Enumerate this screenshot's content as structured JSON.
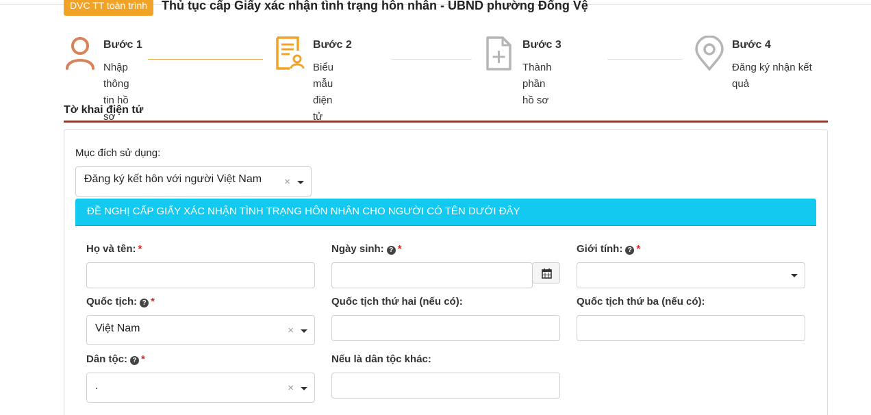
{
  "header": {
    "badge": "DVC TT toàn trình",
    "title": "Thủ tục cấp Giấy xác nhận tình trạng hôn nhân - UBND phường Đống Vệ"
  },
  "steps": [
    {
      "title": "Bước 1",
      "desc": "Nhập thông tin hồ sơ",
      "icon": "user-icon",
      "color": "#d9825a"
    },
    {
      "title": "Bước 2",
      "desc": "Biểu mẫu điện tử",
      "icon": "form-user-icon",
      "color": "#f0a326"
    },
    {
      "title": "Bước 3",
      "desc": "Thành phần hồ sơ",
      "icon": "file-add-icon",
      "color": "#b5b5b5"
    },
    {
      "title": "Bước 4",
      "desc": "Đăng ký nhận kết quả",
      "icon": "location-pin-icon",
      "color": "#b5b5b5"
    }
  ],
  "section": {
    "title": "Tờ khai điện tử"
  },
  "form": {
    "purpose_label": "Mục đích sử dụng:",
    "purpose_value": "Đăng ký kết hôn với người Việt Nam",
    "banner": "ĐỀ NGHỊ CẤP GIẤY XÁC NHẬN TÌNH TRẠNG HÔN NHÂN CHO NGƯỜI CÓ TÊN DƯỚI ĐÂY",
    "fullname_label": "Họ và tên:",
    "dob_label": "Ngày sinh:",
    "gender_label": "Giới tính:",
    "nationality_label": "Quốc tịch:",
    "nationality_value": "Việt Nam",
    "nationality2_label": "Quốc tịch thứ hai (nếu có):",
    "nationality3_label": "Quốc tịch thứ ba (nếu có):",
    "ethnicity_label": "Dân tộc:",
    "ethnicity_value": ".",
    "other_ethnicity_label": "Nếu là dân tộc khác:",
    "required_mark": "*",
    "clear_mark": "×",
    "help_mark": "?"
  }
}
